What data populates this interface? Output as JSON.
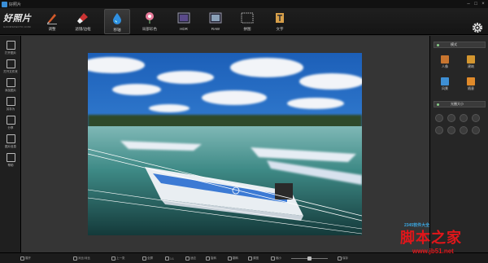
{
  "window": {
    "title": "好照片"
  },
  "logo": {
    "text": "好照片",
    "subtitle": "GOODSPHOTO.COM"
  },
  "toolbar": {
    "tools": [
      {
        "label": "调整",
        "icon": "pen-icon"
      },
      {
        "label": "滤镜/边框",
        "icon": "brush-icon"
      },
      {
        "label": "移轴",
        "icon": "water-drop-icon"
      },
      {
        "label": "局部彩色",
        "icon": "flower-icon"
      },
      {
        "label": "HDR",
        "icon": "hdr-icon"
      },
      {
        "label": "RAW",
        "icon": "raw-icon"
      },
      {
        "label": "拼图",
        "icon": "grid-icon"
      },
      {
        "label": "文字",
        "icon": "text-icon"
      }
    ],
    "active_index": 2
  },
  "leftbar": {
    "items": [
      {
        "label": "打开图片",
        "icon": "open-file-icon"
      },
      {
        "label": "打开文件夹",
        "icon": "open-folder-icon"
      },
      {
        "label": "添加图片",
        "icon": "add-image-icon"
      },
      {
        "label": "另存为",
        "icon": "save-as-icon"
      },
      {
        "label": "分享",
        "icon": "share-icon"
      },
      {
        "label": "图片信息",
        "icon": "info-icon"
      },
      {
        "label": "帮助",
        "icon": "help-icon"
      }
    ]
  },
  "rightbar": {
    "mode_header": "模式",
    "modes": [
      {
        "label": "人像",
        "color": "#c8752f",
        "icon": "portrait-icon"
      },
      {
        "label": "建筑",
        "color": "#d4962f",
        "icon": "building-icon"
      },
      {
        "label": "风景",
        "color": "#3e8fd4",
        "icon": "landscape-icon"
      },
      {
        "label": "随意",
        "color": "#e08a2a",
        "icon": "freeform-icon"
      }
    ],
    "size_header": "光圈大小"
  },
  "bottombar": {
    "buttons": [
      {
        "label": "展开",
        "icon": "expand-icon"
      },
      {
        "label": "对比/对比",
        "icon": "compare-icon"
      },
      {
        "label": "上一张",
        "icon": "prev-icon"
      },
      {
        "label": "全屏",
        "icon": "fullscreen-icon"
      },
      {
        "label": "1:1",
        "icon": "actual-size-icon"
      },
      {
        "label": "适应",
        "icon": "fit-icon"
      },
      {
        "label": "旋转",
        "icon": "rotate-icon"
      },
      {
        "label": "翻转",
        "icon": "flip-icon"
      },
      {
        "label": "原图",
        "icon": "original-icon"
      },
      {
        "label": "缩小",
        "icon": "zoom-out-icon"
      },
      {
        "label": "保存",
        "icon": "save-icon"
      }
    ]
  },
  "watermark": {
    "main": "脚本之家",
    "url": "www.jb51.net",
    "brand": "2345软件大全"
  },
  "colors": {
    "accent": "#3a8fd8",
    "watermark": "#e0161a"
  }
}
